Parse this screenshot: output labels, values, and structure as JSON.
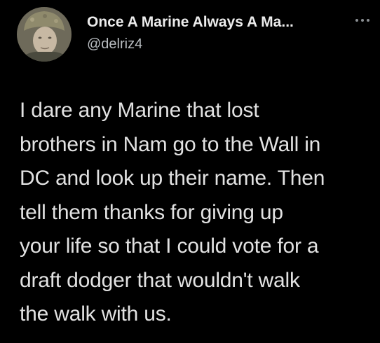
{
  "tweet": {
    "display_name": "Once A Marine Always A Ma...",
    "handle": "@delriz4",
    "more_icon": "more-dots-icon",
    "avatar_icon": "avatar-photo",
    "text_lines": [
      "I dare any Marine that lost",
      "brothers in Nam go to the Wall in",
      "DC and look up their name. Then",
      "tell them thanks for giving up",
      "your life so that I could vote for a",
      "draft dodger that wouldn't walk",
      "the walk with us."
    ]
  },
  "colors": {
    "background": "#000000",
    "name": "#ececec",
    "handle": "#b8bcc0",
    "text": "#e2e2e2"
  }
}
